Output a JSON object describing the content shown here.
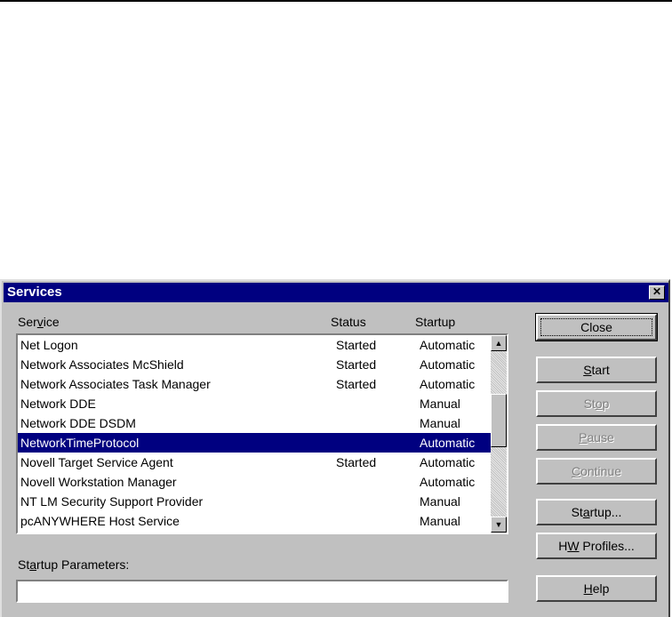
{
  "window": {
    "title": "Services",
    "close_glyph": "✕"
  },
  "columns": {
    "service": "Service",
    "status": "Status",
    "startup": "Startup"
  },
  "services": [
    {
      "name": "Net Logon",
      "status": "Started",
      "startup": "Automatic"
    },
    {
      "name": "Network Associates McShield",
      "status": "Started",
      "startup": "Automatic"
    },
    {
      "name": "Network Associates Task Manager",
      "status": "Started",
      "startup": "Automatic"
    },
    {
      "name": "Network DDE",
      "status": "",
      "startup": "Manual"
    },
    {
      "name": "Network DDE DSDM",
      "status": "",
      "startup": "Manual"
    },
    {
      "name": "NetworkTimeProtocol",
      "status": "",
      "startup": "Automatic",
      "selected": true
    },
    {
      "name": "Novell Target Service Agent",
      "status": "Started",
      "startup": "Automatic"
    },
    {
      "name": "Novell Workstation Manager",
      "status": "",
      "startup": "Automatic"
    },
    {
      "name": "NT LM Security Support Provider",
      "status": "",
      "startup": "Manual"
    },
    {
      "name": "pcANYWHERE Host Service",
      "status": "",
      "startup": "Manual"
    }
  ],
  "buttons": {
    "close": "Close",
    "start": "Start",
    "stop": "Stop",
    "pause": "Pause",
    "continue": "Continue",
    "startup": "Startup...",
    "hw_profiles": "HW Profiles...",
    "help": "Help"
  },
  "startup_parameters": {
    "label": "Startup Parameters:",
    "value": ""
  },
  "colors": {
    "title_bar": "#000080",
    "selection": "#000080",
    "face": "#c0c0c0"
  }
}
